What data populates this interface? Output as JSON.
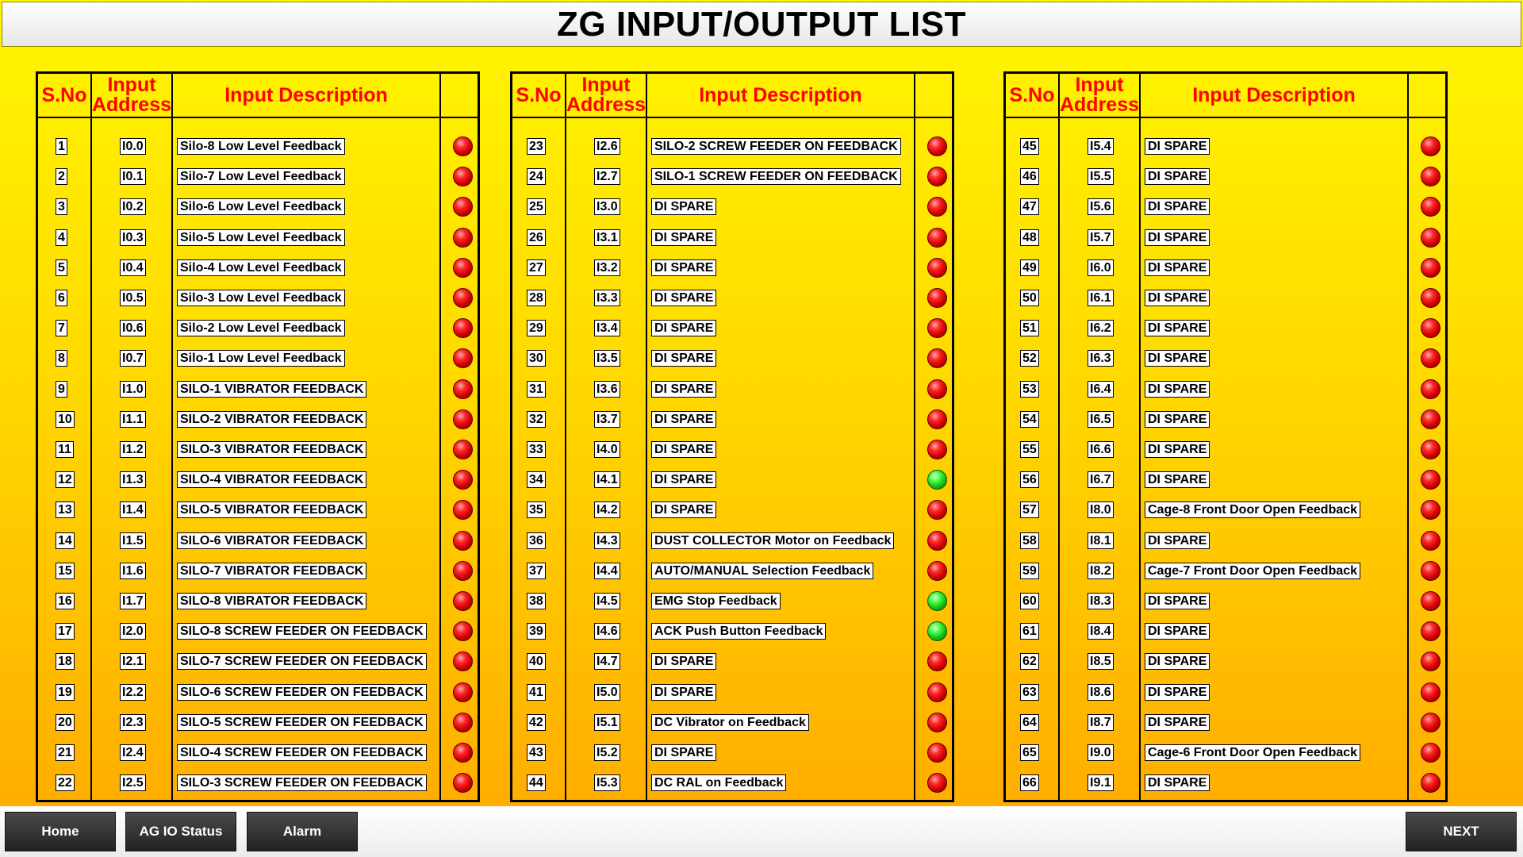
{
  "title": "ZG INPUT/OUTPUT LIST",
  "headers": {
    "sno": "S.No",
    "address_line1": "Input",
    "address_line2": "Address",
    "description": "Input Description"
  },
  "colors": {
    "header_text": "#ff0000",
    "led_off": "#ff0000",
    "led_on": "#00cc00"
  },
  "panels": [
    {
      "rows": [
        {
          "sno": "1",
          "addr": "I0.0",
          "desc": "Silo-8 Low Level Feedback",
          "status": "off"
        },
        {
          "sno": "2",
          "addr": "I0.1",
          "desc": "Silo-7 Low Level Feedback",
          "status": "off"
        },
        {
          "sno": "3",
          "addr": "I0.2",
          "desc": "Silo-6 Low Level Feedback",
          "status": "off"
        },
        {
          "sno": "4",
          "addr": "I0.3",
          "desc": "Silo-5 Low Level Feedback",
          "status": "off"
        },
        {
          "sno": "5",
          "addr": "I0.4",
          "desc": "Silo-4 Low Level Feedback",
          "status": "off"
        },
        {
          "sno": "6",
          "addr": "I0.5",
          "desc": "Silo-3 Low Level Feedback",
          "status": "off"
        },
        {
          "sno": "7",
          "addr": "I0.6",
          "desc": "Silo-2 Low Level Feedback",
          "status": "off"
        },
        {
          "sno": "8",
          "addr": "I0.7",
          "desc": "Silo-1 Low Level Feedback",
          "status": "off"
        },
        {
          "sno": "9",
          "addr": "I1.0",
          "desc": "SILO-1 VIBRATOR FEEDBACK",
          "status": "off"
        },
        {
          "sno": "10",
          "addr": "I1.1",
          "desc": "SILO-2 VIBRATOR FEEDBACK",
          "status": "off"
        },
        {
          "sno": "11",
          "addr": "I1.2",
          "desc": "SILO-3 VIBRATOR FEEDBACK",
          "status": "off"
        },
        {
          "sno": "12",
          "addr": "I1.3",
          "desc": "SILO-4 VIBRATOR FEEDBACK",
          "status": "off"
        },
        {
          "sno": "13",
          "addr": "I1.4",
          "desc": "SILO-5 VIBRATOR FEEDBACK",
          "status": "off"
        },
        {
          "sno": "14",
          "addr": "I1.5",
          "desc": "SILO-6 VIBRATOR FEEDBACK",
          "status": "off"
        },
        {
          "sno": "15",
          "addr": "I1.6",
          "desc": "SILO-7 VIBRATOR FEEDBACK",
          "status": "off"
        },
        {
          "sno": "16",
          "addr": "I1.7",
          "desc": "SILO-8 VIBRATOR FEEDBACK",
          "status": "off"
        },
        {
          "sno": "17",
          "addr": "I2.0",
          "desc": "SILO-8 SCREW FEEDER ON FEEDBACK",
          "status": "off"
        },
        {
          "sno": "18",
          "addr": "I2.1",
          "desc": "SILO-7 SCREW FEEDER ON FEEDBACK",
          "status": "off"
        },
        {
          "sno": "19",
          "addr": "I2.2",
          "desc": "SILO-6 SCREW FEEDER ON FEEDBACK",
          "status": "off"
        },
        {
          "sno": "20",
          "addr": "I2.3",
          "desc": "SILO-5 SCREW FEEDER ON FEEDBACK",
          "status": "off"
        },
        {
          "sno": "21",
          "addr": "I2.4",
          "desc": "SILO-4 SCREW FEEDER ON FEEDBACK",
          "status": "off"
        },
        {
          "sno": "22",
          "addr": "I2.5",
          "desc": "SILO-3 SCREW FEEDER ON FEEDBACK",
          "status": "off"
        }
      ]
    },
    {
      "rows": [
        {
          "sno": "23",
          "addr": "I2.6",
          "desc": "SILO-2 SCREW FEEDER ON FEEDBACK",
          "status": "off"
        },
        {
          "sno": "24",
          "addr": "I2.7",
          "desc": "SILO-1 SCREW FEEDER ON FEEDBACK",
          "status": "off"
        },
        {
          "sno": "25",
          "addr": "I3.0",
          "desc": "DI SPARE",
          "status": "off"
        },
        {
          "sno": "26",
          "addr": "I3.1",
          "desc": "DI SPARE",
          "status": "off"
        },
        {
          "sno": "27",
          "addr": "I3.2",
          "desc": "DI SPARE",
          "status": "off"
        },
        {
          "sno": "28",
          "addr": "I3.3",
          "desc": "DI SPARE",
          "status": "off"
        },
        {
          "sno": "29",
          "addr": "I3.4",
          "desc": "DI SPARE",
          "status": "off"
        },
        {
          "sno": "30",
          "addr": "I3.5",
          "desc": "DI SPARE",
          "status": "off"
        },
        {
          "sno": "31",
          "addr": "I3.6",
          "desc": "DI SPARE",
          "status": "off"
        },
        {
          "sno": "32",
          "addr": "I3.7",
          "desc": "DI SPARE",
          "status": "off"
        },
        {
          "sno": "33",
          "addr": "I4.0",
          "desc": "DI SPARE",
          "status": "off"
        },
        {
          "sno": "34",
          "addr": "I4.1",
          "desc": "DI SPARE",
          "status": "on"
        },
        {
          "sno": "35",
          "addr": "I4.2",
          "desc": "DI SPARE",
          "status": "off"
        },
        {
          "sno": "36",
          "addr": "I4.3",
          "desc": "DUST COLLECTOR Motor on Feedback",
          "status": "off"
        },
        {
          "sno": "37",
          "addr": "I4.4",
          "desc": "AUTO/MANUAL Selection Feedback",
          "status": "off"
        },
        {
          "sno": "38",
          "addr": "I4.5",
          "desc": "EMG Stop Feedback",
          "status": "on"
        },
        {
          "sno": "39",
          "addr": "I4.6",
          "desc": "ACK Push Button Feedback",
          "status": "on"
        },
        {
          "sno": "40",
          "addr": "I4.7",
          "desc": "DI SPARE",
          "status": "off"
        },
        {
          "sno": "41",
          "addr": "I5.0",
          "desc": "DI SPARE",
          "status": "off"
        },
        {
          "sno": "42",
          "addr": "I5.1",
          "desc": "DC Vibrator on Feedback",
          "status": "off"
        },
        {
          "sno": "43",
          "addr": "I5.2",
          "desc": "DI SPARE",
          "status": "off"
        },
        {
          "sno": "44",
          "addr": "I5.3",
          "desc": "DC RAL on Feedback",
          "status": "off"
        }
      ]
    },
    {
      "rows": [
        {
          "sno": "45",
          "addr": "I5.4",
          "desc": "DI SPARE",
          "status": "off"
        },
        {
          "sno": "46",
          "addr": "I5.5",
          "desc": "DI SPARE",
          "status": "off"
        },
        {
          "sno": "47",
          "addr": "I5.6",
          "desc": "DI SPARE",
          "status": "off"
        },
        {
          "sno": "48",
          "addr": "I5.7",
          "desc": "DI SPARE",
          "status": "off"
        },
        {
          "sno": "49",
          "addr": "I6.0",
          "desc": "DI SPARE",
          "status": "off"
        },
        {
          "sno": "50",
          "addr": "I6.1",
          "desc": "DI SPARE",
          "status": "off"
        },
        {
          "sno": "51",
          "addr": "I6.2",
          "desc": "DI SPARE",
          "status": "off"
        },
        {
          "sno": "52",
          "addr": "I6.3",
          "desc": "DI SPARE",
          "status": "off"
        },
        {
          "sno": "53",
          "addr": "I6.4",
          "desc": "DI SPARE",
          "status": "off"
        },
        {
          "sno": "54",
          "addr": "I6.5",
          "desc": "DI SPARE",
          "status": "off"
        },
        {
          "sno": "55",
          "addr": "I6.6",
          "desc": "DI SPARE",
          "status": "off"
        },
        {
          "sno": "56",
          "addr": "I6.7",
          "desc": "DI SPARE",
          "status": "off"
        },
        {
          "sno": "57",
          "addr": "I8.0",
          "desc": "Cage-8 Front Door Open Feedback",
          "status": "off"
        },
        {
          "sno": "58",
          "addr": "I8.1",
          "desc": "DI SPARE",
          "status": "off"
        },
        {
          "sno": "59",
          "addr": "I8.2",
          "desc": "Cage-7 Front Door Open Feedback",
          "status": "off"
        },
        {
          "sno": "60",
          "addr": "I8.3",
          "desc": "DI SPARE",
          "status": "off"
        },
        {
          "sno": "61",
          "addr": "I8.4",
          "desc": "DI SPARE",
          "status": "off"
        },
        {
          "sno": "62",
          "addr": "I8.5",
          "desc": "DI SPARE",
          "status": "off"
        },
        {
          "sno": "63",
          "addr": "I8.6",
          "desc": "DI SPARE",
          "status": "off"
        },
        {
          "sno": "64",
          "addr": "I8.7",
          "desc": "DI SPARE",
          "status": "off"
        },
        {
          "sno": "65",
          "addr": "I9.0",
          "desc": "Cage-6 Front Door Open Feedback",
          "status": "off"
        },
        {
          "sno": "66",
          "addr": "I9.1",
          "desc": "DI SPARE",
          "status": "off"
        }
      ]
    }
  ],
  "footer": {
    "home": "Home",
    "ag_io_status": "AG IO Status",
    "alarm": "Alarm",
    "next": "NEXT"
  }
}
